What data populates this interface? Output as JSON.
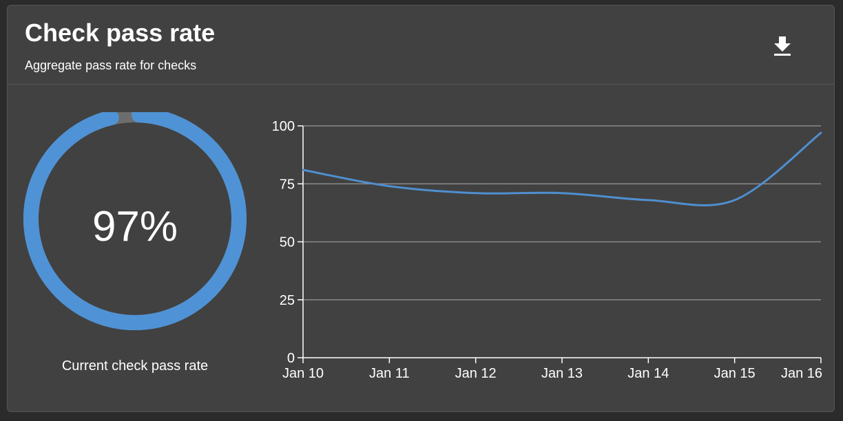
{
  "header": {
    "title": "Check pass rate",
    "subtitle": "Aggregate pass rate for checks"
  },
  "toolbar": {
    "download_icon": "download-icon"
  },
  "gauge": {
    "value": 97,
    "value_label": "97%",
    "caption": "Current check pass rate",
    "color": "#4f93d6",
    "track_color": "#6d6d6d"
  },
  "colors": {
    "background": "#414141",
    "line": "#4f8fd0",
    "grid": "#8a8a8a",
    "text": "#ffffff"
  },
  "chart_data": {
    "type": "line",
    "categories": [
      "Jan 10",
      "Jan 11",
      "Jan 12",
      "Jan 13",
      "Jan 14",
      "Jan 15",
      "Jan 16"
    ],
    "series": [
      {
        "values": [
          81,
          74,
          71,
          71,
          68,
          68,
          97
        ]
      }
    ],
    "yticks": [
      0,
      25,
      50,
      75,
      100
    ],
    "ylim": [
      0,
      100
    ],
    "grid": true,
    "title": "",
    "xlabel": "",
    "ylabel": ""
  }
}
